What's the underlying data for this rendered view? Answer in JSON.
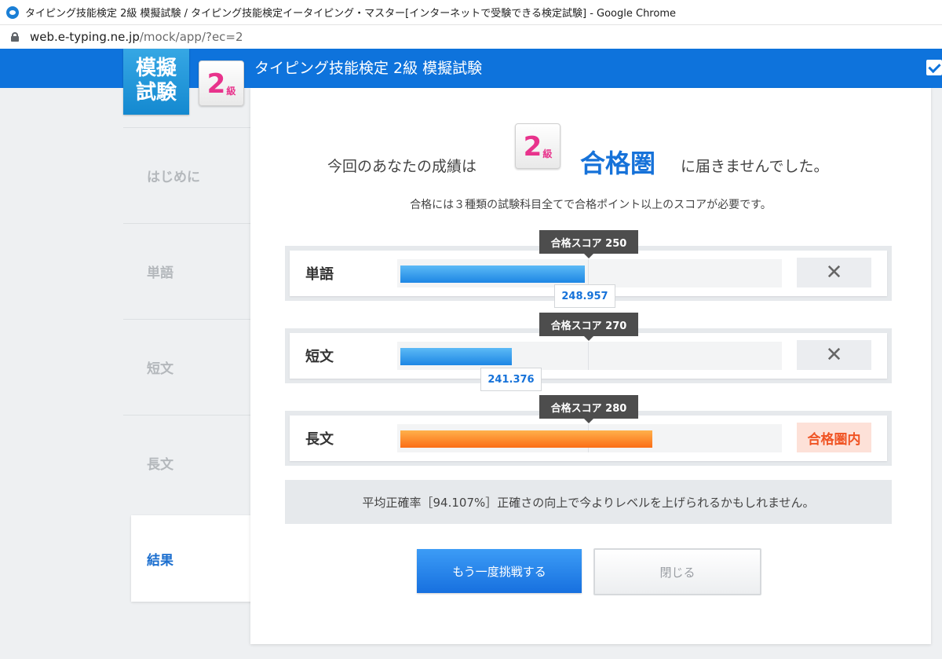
{
  "browser": {
    "window_title": "タイピング技能検定 2級 模擬試験 / タイピング技能検定イータイピング・マスター[インターネットで受験できる検定試験] - Google Chrome",
    "url_host": "web.e-typing.ne.jp",
    "url_path": "/mock/app/?ec=2"
  },
  "header": {
    "logo_line1": "模擬",
    "logo_line2": "試験",
    "grade_number": "2",
    "grade_unit": "級",
    "title": "タイピング技能検定 2級 模擬試験"
  },
  "sidebar": {
    "items": [
      {
        "label": "はじめに",
        "active": false
      },
      {
        "label": "単語",
        "active": false
      },
      {
        "label": "短文",
        "active": false
      },
      {
        "label": "長文",
        "active": false
      },
      {
        "label": "結果",
        "active": true
      }
    ]
  },
  "result": {
    "prefix": "今回のあなたの成績は",
    "grade_number": "2",
    "grade_unit": "級",
    "highlight": "合格圏",
    "suffix": "に届きませんでした。",
    "note": "合格には３種類の試験科目全てで合格ポイント以上のスコアが必要です。"
  },
  "subjects": [
    {
      "name": "単語",
      "pass_label": "合格スコア 250",
      "score_label": "248.957",
      "score": 248.957,
      "pass_score": 250,
      "fill_fraction": 0.48,
      "passed": false,
      "status": "✕"
    },
    {
      "name": "短文",
      "pass_label": "合格スコア 270",
      "score_label": "241.376",
      "score": 241.376,
      "pass_score": 270,
      "fill_fraction": 0.29,
      "passed": false,
      "status": "✕"
    },
    {
      "name": "長文",
      "pass_label": "合格スコア 280",
      "score_label": "",
      "pass_score": 280,
      "fill_fraction": 0.655,
      "passed": true,
      "status": "合格圏内"
    }
  ],
  "accuracy": {
    "text": "平均正確率［94.107%］正確さの向上で今よりレベルを上げられるかもしれません。"
  },
  "buttons": {
    "retry": "もう一度挑戦する",
    "close": "閉じる"
  },
  "colors": {
    "header_blue": "#0e73dc",
    "accent_blue": "#1672d9",
    "grade_pink": "#e8338c",
    "pass_orange": "#f05424"
  }
}
